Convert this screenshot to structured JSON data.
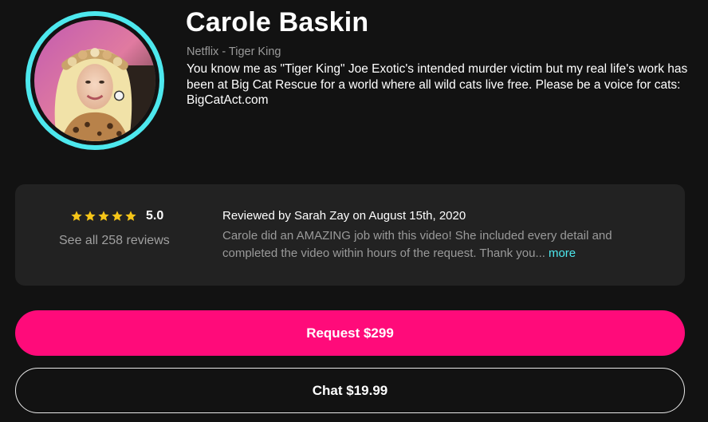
{
  "profile": {
    "name": "Carole Baskin",
    "subtitle": "Netflix - Tiger King",
    "bio": "You know me as \"Tiger King\" Joe Exotic's intended murder victim but my real life's work has been at Big Cat Rescue for a world where all wild cats live free. Please be a voice for cats: BigCatAct.com",
    "avatar_ring_color": "#4de8ee"
  },
  "review_summary": {
    "stars": 5,
    "rating": "5.0",
    "see_all_label": "See all 258 reviews",
    "star_color": "#f5c518"
  },
  "featured_review": {
    "reviewer_line": "Reviewed by Sarah Zay on August 15th, 2020",
    "text": "Carole did an AMAZING job with this video! She included every detail and completed the video within hours of the request. Thank you...",
    "more_label": "more",
    "more_color": "#4de8ee"
  },
  "actions": {
    "request_label": "Request $299",
    "request_color": "#ff0b7a",
    "chat_label": "Chat $19.99"
  }
}
